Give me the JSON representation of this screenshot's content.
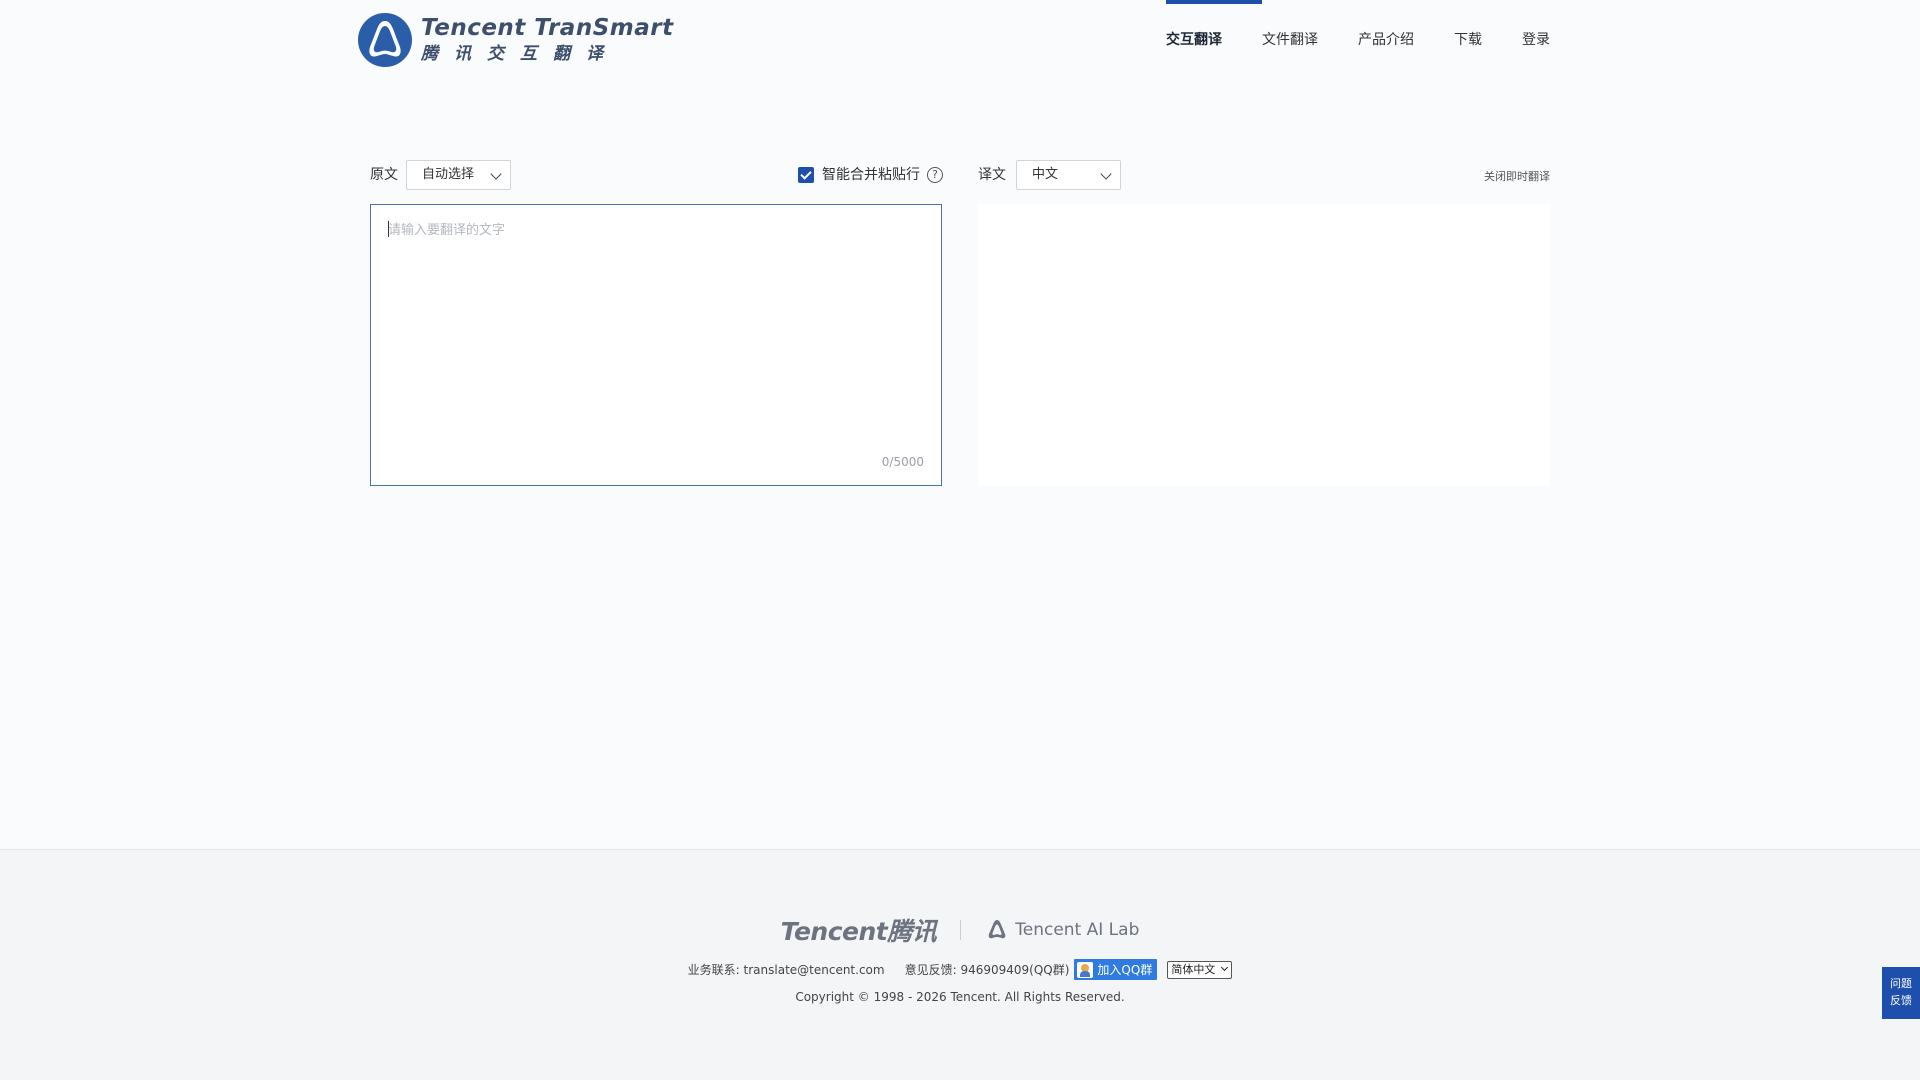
{
  "logo": {
    "en": "Tencent TranSmart",
    "cn": "腾讯交互翻译"
  },
  "nav": {
    "items": [
      {
        "label": "交互翻译"
      },
      {
        "label": "文件翻译"
      },
      {
        "label": "产品介绍"
      },
      {
        "label": "下载"
      },
      {
        "label": "登录"
      }
    ]
  },
  "source": {
    "label": "原文",
    "language": "自动选择",
    "merge_label": "智能合并粘贴行",
    "merge_checked": true,
    "help": "?",
    "placeholder": "请输入要翻译的文字",
    "counter": "0/5000"
  },
  "target": {
    "label": "译文",
    "language": "中文",
    "instant_toggle": "关闭即时翻译"
  },
  "footer": {
    "tencent_logo": "Tencent腾讯",
    "ailab": "Tencent AI Lab",
    "contact": "业务联系: translate@tencent.com",
    "feedback_text": "意见反馈: 946909409(QQ群)",
    "qq_button": "加入QQ群",
    "ui_language": "简体中文",
    "copyright": "Copyright © 1998 - 2026 Tencent. All Rights Reserved."
  },
  "feedback_float": {
    "line1": "问题",
    "line2": "反馈"
  },
  "colors": {
    "accent": "#1e4fad",
    "logo": "#3d4f6c",
    "border": "#3f74b8"
  }
}
